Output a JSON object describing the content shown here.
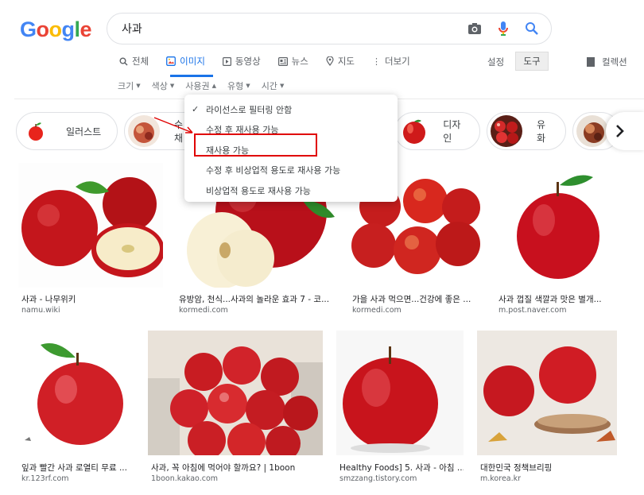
{
  "logo": {
    "letters": [
      "G",
      "o",
      "o",
      "g",
      "l",
      "e"
    ],
    "colors": [
      "#4285f4",
      "#ea4335",
      "#fbbc05",
      "#4285f4",
      "#34a853",
      "#ea4335"
    ]
  },
  "search": {
    "query": "사과",
    "icons": [
      "camera-icon",
      "microphone-icon",
      "search-icon"
    ]
  },
  "tabs": [
    {
      "label": "전체",
      "icon": "search-icon",
      "glyph": "⚲"
    },
    {
      "label": "이미지",
      "icon": "image-icon",
      "glyph": "▣",
      "active": true
    },
    {
      "label": "동영상",
      "icon": "video-icon",
      "glyph": "▶"
    },
    {
      "label": "뉴스",
      "icon": "news-icon",
      "glyph": "▤"
    },
    {
      "label": "지도",
      "icon": "map-pin-icon",
      "glyph": "⚲"
    },
    {
      "label": "더보기",
      "icon": "more-vert-icon",
      "glyph": "⋮"
    }
  ],
  "toolbar": {
    "settings": "설정",
    "tools": "도구",
    "collection": "컬렉션"
  },
  "filters": [
    {
      "label": "크기",
      "caret": "▼"
    },
    {
      "label": "색상",
      "caret": "▼"
    },
    {
      "label": "사용권",
      "caret": "▲"
    },
    {
      "label": "유형",
      "caret": "▼"
    },
    {
      "label": "시간",
      "caret": "▼"
    }
  ],
  "chips": [
    "일러스트",
    "수채",
    "디자인",
    "유화"
  ],
  "dropdown": {
    "items": [
      {
        "label": "라이선스로 필터링 안함",
        "checked": true
      },
      {
        "label": "수정 후 재사용 가능",
        "checked": false
      },
      {
        "label": "재사용 가능",
        "checked": false
      },
      {
        "label": "수정 후 비상업적 용도로 재사용 가능",
        "checked": false
      },
      {
        "label": "비상업적 용도로 재사용 가능",
        "checked": false
      }
    ],
    "check_glyph": "✓"
  },
  "results": [
    {
      "caption": "사과 - 나무위키",
      "source": "namu.wiki"
    },
    {
      "caption": "유방암, 천식...사과의 놀라운 효과 7 - 코...",
      "source": "kormedi.com"
    },
    {
      "caption": "가을 사과 먹으면...건강에 좋은 ...",
      "source": "kormedi.com"
    },
    {
      "caption": "사과 껍질 색깔과 맛은 별개...",
      "source": "m.post.naver.com"
    },
    {
      "caption": "잎과 빨간 사과 로열티 무료 ...",
      "source": "kr.123rf.com"
    },
    {
      "caption": "사과, 꼭 아침에 먹어야 할까요? | 1boon",
      "source": "1boon.kakao.com"
    },
    {
      "caption": "Healthy Foods] 5. 사과 - 아침 ...",
      "source": "smzzang.tistory.com"
    },
    {
      "caption": "대한민국 정책브리핑",
      "source": "m.korea.kr"
    }
  ],
  "colors": {
    "accent": "#1a73e8",
    "highlight": "#e00000",
    "apple": "#c8102e"
  }
}
